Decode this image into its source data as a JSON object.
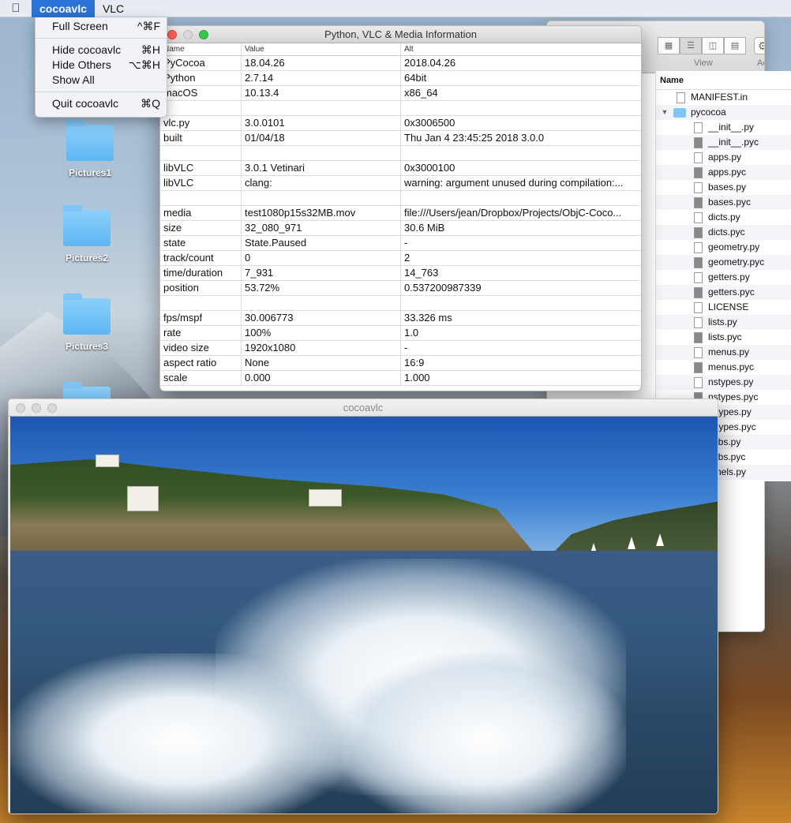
{
  "menubar": {
    "app_name": "cocoavlc",
    "menus": [
      "VLC"
    ]
  },
  "app_menu": {
    "items": [
      {
        "label": "Full Screen",
        "shortcut": "^⌘F"
      },
      {
        "label": "Hide cocoavlc",
        "shortcut": "⌘H"
      },
      {
        "label": "Hide Others",
        "shortcut": "⌥⌘H"
      },
      {
        "label": "Show All",
        "shortcut": ""
      },
      {
        "label": "Quit cocoavlc",
        "shortcut": "⌘Q"
      }
    ]
  },
  "desktop": {
    "folders": [
      "Pictures1",
      "Pictures2",
      "Pictures3"
    ]
  },
  "finder": {
    "toolbar": {
      "view_label": "View",
      "action_label": "Action"
    },
    "column_header": "Name",
    "items": [
      {
        "name": "MANIFEST.in",
        "kind": "doc"
      },
      {
        "name": "pycocoa",
        "kind": "folder"
      },
      {
        "name": "__init__.py",
        "kind": "py"
      },
      {
        "name": "__init__.pyc",
        "kind": "pyc"
      },
      {
        "name": "apps.py",
        "kind": "py"
      },
      {
        "name": "apps.pyc",
        "kind": "pyc"
      },
      {
        "name": "bases.py",
        "kind": "py"
      },
      {
        "name": "bases.pyc",
        "kind": "pyc"
      },
      {
        "name": "dicts.py",
        "kind": "py"
      },
      {
        "name": "dicts.pyc",
        "kind": "pyc"
      },
      {
        "name": "geometry.py",
        "kind": "py"
      },
      {
        "name": "geometry.pyc",
        "kind": "pyc"
      },
      {
        "name": "getters.py",
        "kind": "py"
      },
      {
        "name": "getters.pyc",
        "kind": "pyc"
      },
      {
        "name": "LICENSE",
        "kind": "doc"
      },
      {
        "name": "lists.py",
        "kind": "py"
      },
      {
        "name": "lists.pyc",
        "kind": "pyc"
      },
      {
        "name": "menus.py",
        "kind": "py"
      },
      {
        "name": "menus.pyc",
        "kind": "pyc"
      },
      {
        "name": "nstypes.py",
        "kind": "py"
      },
      {
        "name": "nstypes.pyc",
        "kind": "pyc"
      },
      {
        "name": "...types.py",
        "kind": "py"
      },
      {
        "name": "...types.pyc",
        "kind": "pyc"
      },
      {
        "name": "...ibs.py",
        "kind": "py"
      },
      {
        "name": "...ibs.pyc",
        "kind": "pyc"
      },
      {
        "name": "...nels.py",
        "kind": "py"
      }
    ]
  },
  "info_window": {
    "title": "Python, VLC & Media Information",
    "columns": [
      "Name",
      "Value",
      "Alt"
    ],
    "rows": [
      [
        "PyCocoa",
        "18.04.26",
        "2018.04.26"
      ],
      [
        "Python",
        "2.7.14",
        "64bit"
      ],
      [
        "macOS",
        "10.13.4",
        "x86_64"
      ],
      [
        "",
        "",
        ""
      ],
      [
        "vlc.py",
        "3.0.0101",
        "0x3006500"
      ],
      [
        "built",
        "01/04/18",
        "Thu Jan  4 23:45:25 2018 3.0.0"
      ],
      [
        "",
        "",
        ""
      ],
      [
        "libVLC",
        "3.0.1 Vetinari",
        "0x3000100"
      ],
      [
        "libVLC",
        "clang:",
        "warning: argument unused during compilation:..."
      ],
      [
        "",
        "",
        ""
      ],
      [
        "media",
        "test1080p15s32MB.mov",
        "file:///Users/jean/Dropbox/Projects/ObjC-Coco..."
      ],
      [
        "size",
        "32_080_971",
        "30.6 MiB"
      ],
      [
        "state",
        "State.Paused",
        "-"
      ],
      [
        "track/count",
        "0",
        "2"
      ],
      [
        "time/duration",
        "7_931",
        "14_763"
      ],
      [
        "position",
        "53.72%",
        "0.537200987339"
      ],
      [
        "",
        "",
        ""
      ],
      [
        "fps/mspf",
        "30.006773",
        "33.326 ms"
      ],
      [
        "rate",
        "100%",
        "1.0"
      ],
      [
        "video size",
        "1920x1080",
        "-"
      ],
      [
        "aspect ratio",
        "None",
        "16:9"
      ],
      [
        "scale",
        "0.000",
        "1.000"
      ]
    ]
  },
  "video_window": {
    "title": "cocoavlc"
  }
}
